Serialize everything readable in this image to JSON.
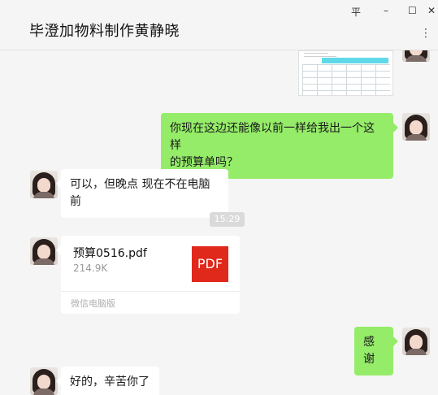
{
  "window": {
    "title": "毕澄加物料制作黄静晓",
    "pin_glyph": "平",
    "minimize_glyph": "–",
    "maximize_glyph": "☐",
    "close_glyph": "✕",
    "more_glyph": "⋮"
  },
  "messages": [
    {
      "type": "image",
      "side": "right",
      "description_icon": "spreadsheet-preview"
    },
    {
      "type": "text",
      "side": "right",
      "lines": [
        "你现在这边还能像以前一样给我出一个这样",
        "的预算单吗？"
      ]
    },
    {
      "type": "text",
      "side": "left",
      "text": "可以，但晚点 现在不在电脑前"
    },
    {
      "type": "time",
      "text": "15:29"
    },
    {
      "type": "file",
      "side": "left",
      "file_name": "预算0516.pdf",
      "file_size": "214.9K",
      "icon_label": "PDF",
      "source": "微信电脑版"
    },
    {
      "type": "text",
      "side": "right",
      "text": "感谢"
    },
    {
      "type": "text",
      "side": "left",
      "text": "好的，辛苦你了"
    }
  ],
  "colors": {
    "own_bubble": "#95ec69",
    "other_bubble": "#ffffff",
    "background": "#f5f5f5",
    "pdf_icon": "#e0281b"
  }
}
